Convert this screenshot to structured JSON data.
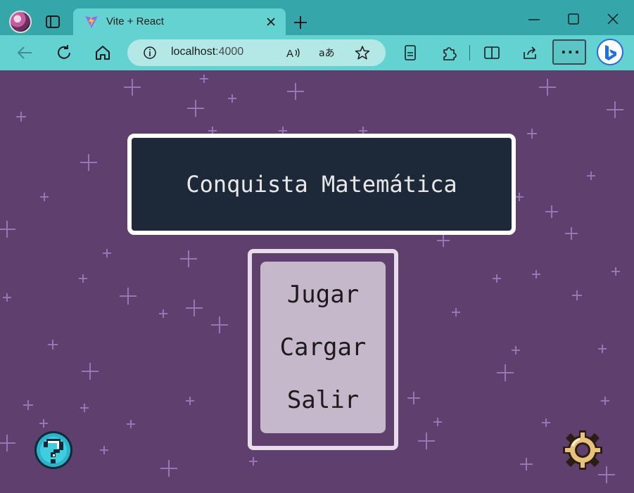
{
  "browser": {
    "tab": {
      "title": "Vite + React"
    },
    "address": {
      "host": "localhost",
      "port": ":4000"
    },
    "more_label": "···"
  },
  "colors": {
    "chrome": "#35a7ab",
    "toolbar": "#65d2d2",
    "page_background": "#5e3f6e",
    "title_box": "#1d2838",
    "menu_panel": "#c6b8cb",
    "star": "#9b74b8"
  },
  "game": {
    "title": "Conquista Matemática",
    "menu": [
      {
        "label": "Jugar"
      },
      {
        "label": "Cargar"
      },
      {
        "label": "Salir"
      }
    ],
    "help_icon": "question-mark-icon",
    "settings_icon": "gear-icon"
  }
}
